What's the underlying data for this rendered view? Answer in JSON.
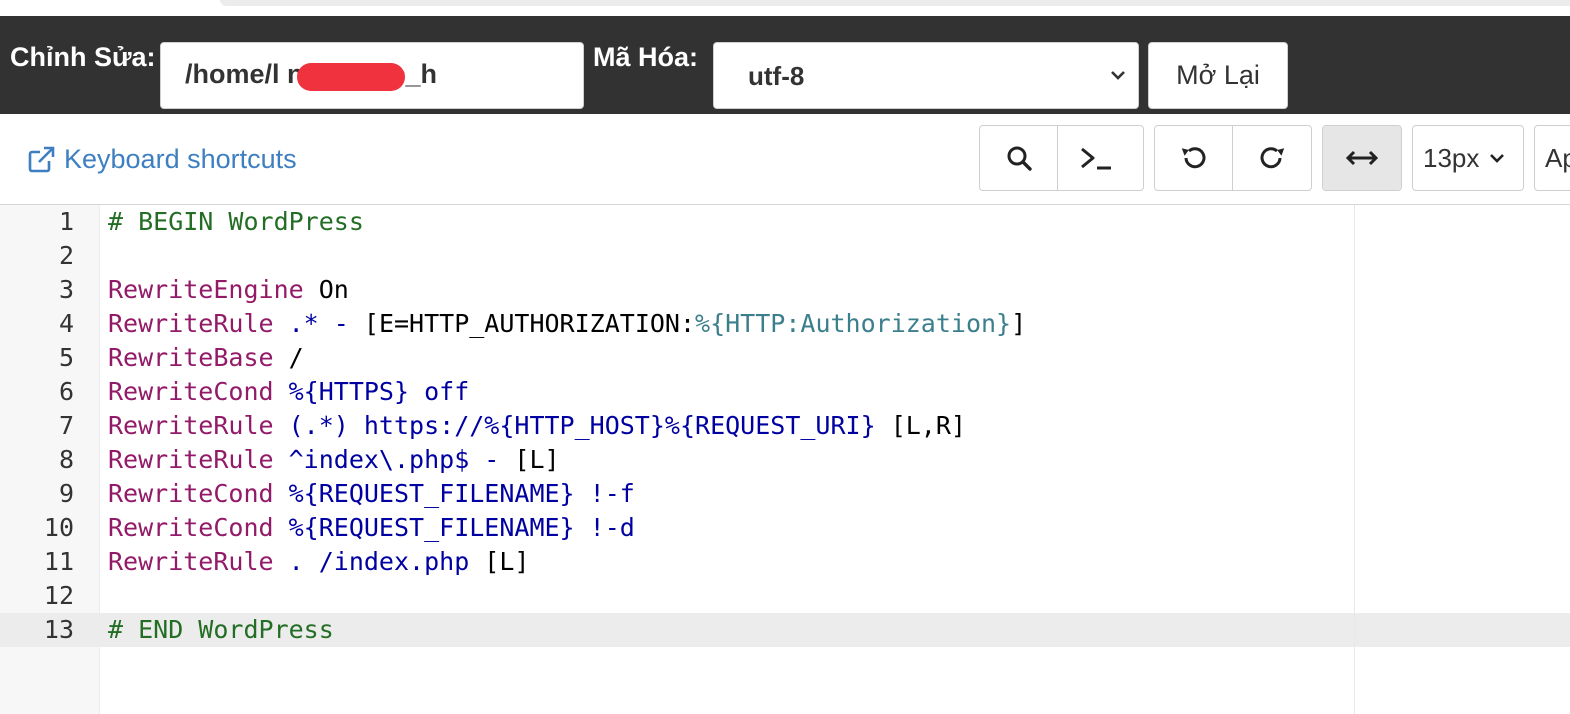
{
  "header": {
    "edit_label": "Chỉnh Sửa:",
    "path_value": "/home/l          ns/public_h",
    "encoding_label": "Mã Hóa:",
    "encoding_value": "utf-8",
    "reopen_label": "Mở Lại"
  },
  "toolbar": {
    "keyboard_shortcuts": "Keyboard shortcuts",
    "buttons": [
      "search-icon",
      "terminal-icon",
      "undo-icon",
      "redo-icon",
      "wrap-icon"
    ],
    "font_size": "13px",
    "cutoff_label": "Ap"
  },
  "editor": {
    "line_numbers": [
      "1",
      "2",
      "3",
      "4",
      "5",
      "6",
      "7",
      "8",
      "9",
      "10",
      "11",
      "12",
      "13"
    ],
    "lines": [
      [
        {
          "t": "# BEGIN WordPress",
          "c": "comment"
        }
      ],
      [],
      [
        {
          "t": "RewriteEngine",
          "c": "kw"
        },
        {
          "t": " On",
          "c": "plain"
        }
      ],
      [
        {
          "t": "RewriteRule",
          "c": "kw"
        },
        {
          "t": " .* - ",
          "c": "blue"
        },
        {
          "t": "[E=HTTP_AUTHORIZATION:",
          "c": "plain"
        },
        {
          "t": "%{HTTP:Authorization}",
          "c": "var"
        },
        {
          "t": "]",
          "c": "plain"
        }
      ],
      [
        {
          "t": "RewriteBase",
          "c": "kw"
        },
        {
          "t": " /",
          "c": "plain"
        }
      ],
      [
        {
          "t": "RewriteCond",
          "c": "kw"
        },
        {
          "t": " %{HTTPS} off",
          "c": "blue"
        }
      ],
      [
        {
          "t": "RewriteRule",
          "c": "kw"
        },
        {
          "t": " (.*) https://%{HTTP_HOST}%{REQUEST_URI}",
          "c": "blue"
        },
        {
          "t": " [L,R]",
          "c": "plain"
        }
      ],
      [
        {
          "t": "RewriteRule",
          "c": "kw"
        },
        {
          "t": " ^index\\.php$ -",
          "c": "blue"
        },
        {
          "t": " [L]",
          "c": "plain"
        }
      ],
      [
        {
          "t": "RewriteCond",
          "c": "kw"
        },
        {
          "t": " %{REQUEST_FILENAME} !-f",
          "c": "blue"
        }
      ],
      [
        {
          "t": "RewriteCond",
          "c": "kw"
        },
        {
          "t": " %{REQUEST_FILENAME} !-d",
          "c": "blue"
        }
      ],
      [
        {
          "t": "RewriteRule",
          "c": "kw"
        },
        {
          "t": " . /index.php",
          "c": "blue"
        },
        {
          "t": " [L]",
          "c": "plain"
        }
      ],
      [],
      [
        {
          "t": "# END WordPress",
          "c": "comment"
        }
      ]
    ]
  },
  "colors": {
    "topbar_bg": "#323232",
    "link_blue": "#3d7fc1",
    "comment": "#236e24",
    "keyword": "#931a68",
    "variable": "#3c7f8c",
    "value": "#0000a2",
    "redaction": "#f0323f"
  }
}
